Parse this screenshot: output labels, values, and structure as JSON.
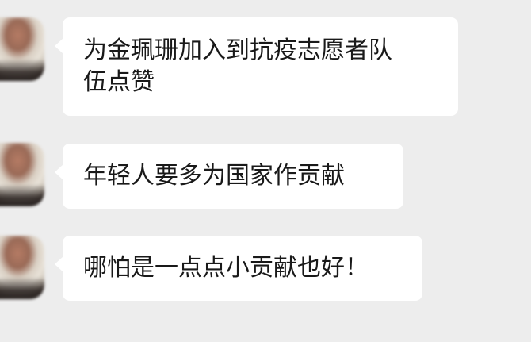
{
  "messages": [
    {
      "text": "为金珮珊加入到抗疫志愿者队\n伍点赞"
    },
    {
      "text": "年轻人要多为国家作贡献"
    },
    {
      "text": "哪怕是一点点小贡献也好！"
    }
  ],
  "colors": {
    "background": "#ededed",
    "bubble": "#ffffff",
    "text": "#191919"
  }
}
